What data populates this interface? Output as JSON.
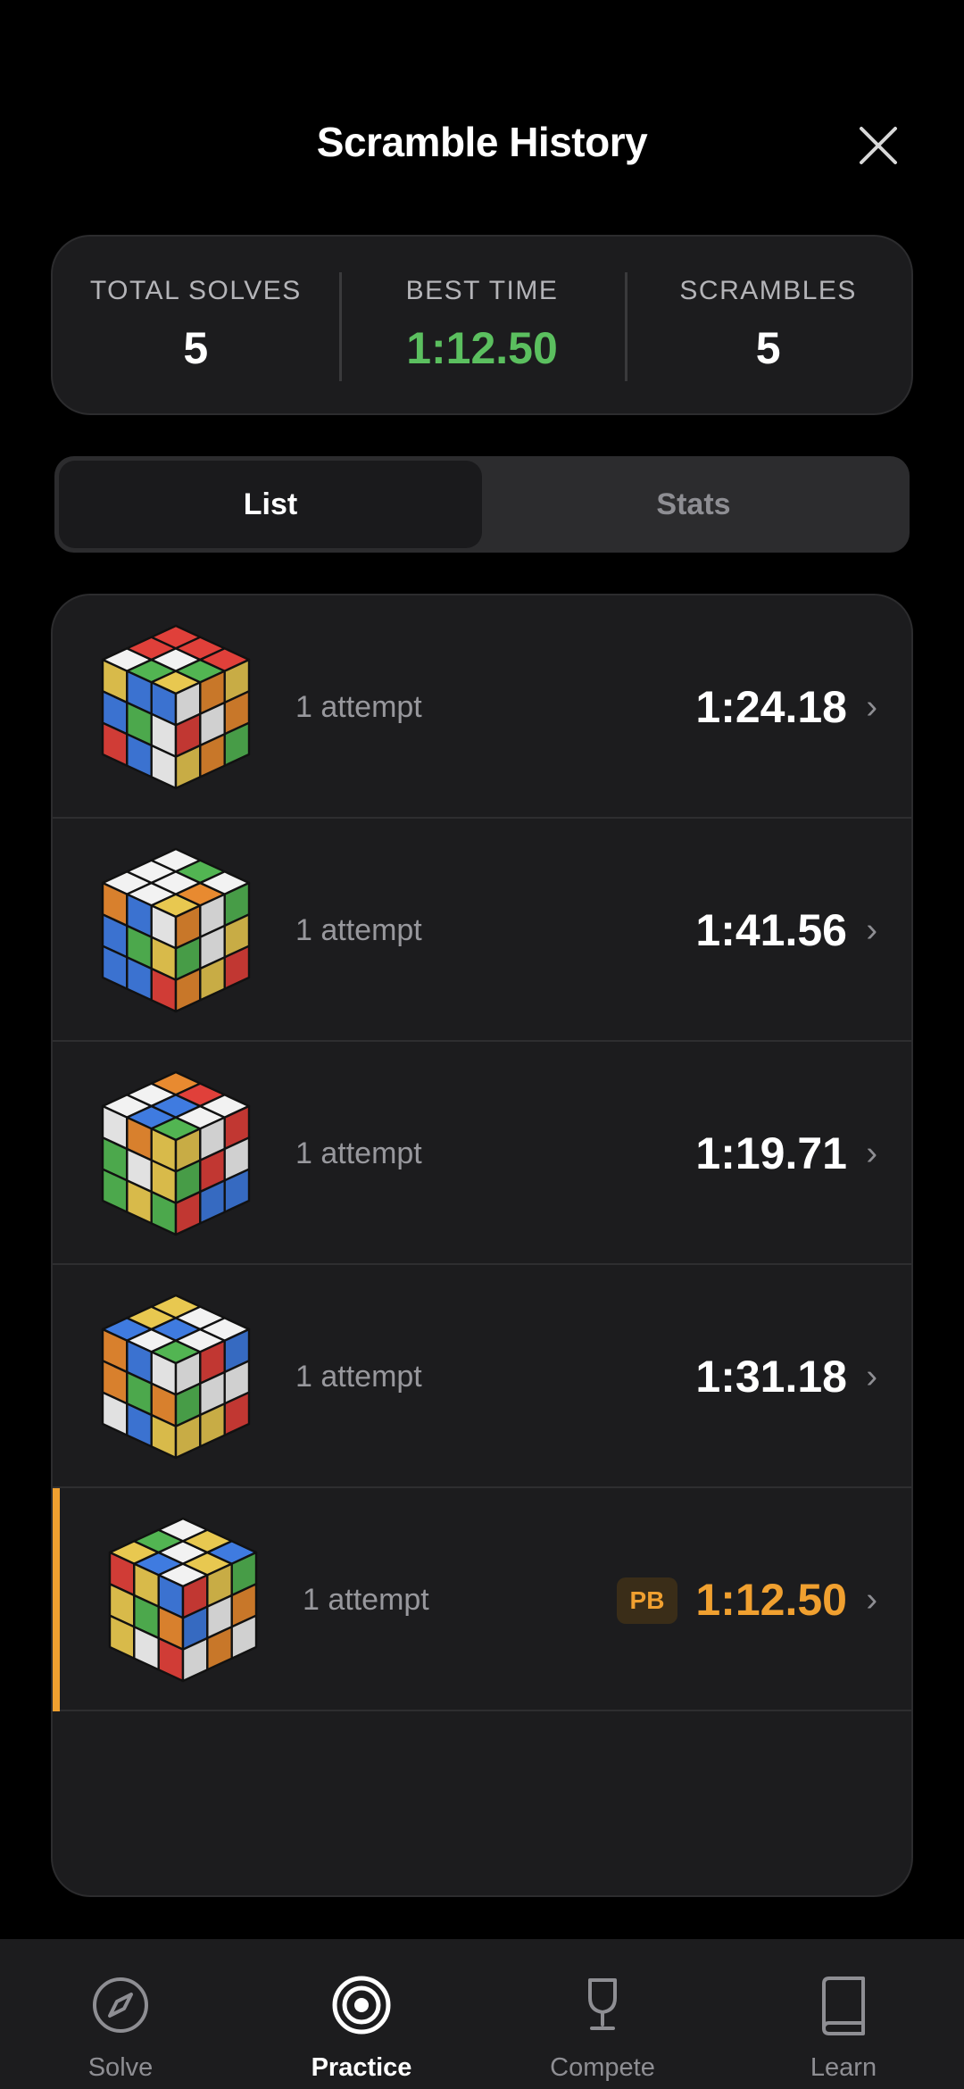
{
  "header": {
    "title": "Scramble History"
  },
  "summary": {
    "total_label": "TOTAL SOLVES",
    "total_value": "5",
    "best_label": "BEST TIME",
    "best_value": "1:12.50",
    "scrambles_label": "SCRAMBLES",
    "scrambles_value": "5",
    "best_color": "#5bbf5f"
  },
  "segments": {
    "list": "List",
    "stats": "Stats",
    "active": "List"
  },
  "scrambles": [
    {
      "attempts": "1 attempt",
      "time": "1:24.18",
      "pb": false,
      "top": [
        "w",
        "r",
        "r",
        "g",
        "w",
        "r",
        "y",
        "g",
        "r"
      ],
      "left": [
        "y",
        "b",
        "b",
        "b",
        "g",
        "w",
        "r",
        "b",
        "w"
      ],
      "right": [
        "w",
        "o",
        "y",
        "r",
        "w",
        "o",
        "y",
        "o",
        "g"
      ]
    },
    {
      "attempts": "1 attempt",
      "time": "1:41.56",
      "pb": false,
      "top": [
        "w",
        "w",
        "w",
        "w",
        "w",
        "g",
        "y",
        "o",
        "w"
      ],
      "left": [
        "o",
        "b",
        "w",
        "b",
        "g",
        "y",
        "b",
        "b",
        "r"
      ],
      "right": [
        "o",
        "w",
        "g",
        "g",
        "w",
        "y",
        "o",
        "y",
        "r"
      ]
    },
    {
      "attempts": "1 attempt",
      "time": "1:19.71",
      "pb": false,
      "top": [
        "w",
        "w",
        "o",
        "b",
        "b",
        "r",
        "g",
        "w",
        "w"
      ],
      "left": [
        "w",
        "o",
        "y",
        "g",
        "w",
        "y",
        "g",
        "y",
        "g"
      ],
      "right": [
        "y",
        "w",
        "r",
        "g",
        "r",
        "w",
        "r",
        "b",
        "b"
      ]
    },
    {
      "attempts": "1 attempt",
      "time": "1:31.18",
      "pb": false,
      "top": [
        "b",
        "y",
        "y",
        "w",
        "b",
        "w",
        "g",
        "w",
        "w"
      ],
      "left": [
        "o",
        "b",
        "w",
        "o",
        "g",
        "o",
        "w",
        "b",
        "y"
      ],
      "right": [
        "w",
        "r",
        "b",
        "g",
        "w",
        "w",
        "y",
        "y",
        "r"
      ]
    },
    {
      "attempts": "1 attempt",
      "time": "1:12.50",
      "pb": true,
      "badge": "PB",
      "top": [
        "y",
        "g",
        "w",
        "b",
        "w",
        "y",
        "w",
        "y",
        "b"
      ],
      "left": [
        "r",
        "y",
        "b",
        "y",
        "g",
        "o",
        "y",
        "w",
        "r"
      ],
      "right": [
        "r",
        "y",
        "g",
        "b",
        "w",
        "o",
        "w",
        "o",
        "w"
      ]
    }
  ],
  "tabs": [
    {
      "label": "Solve",
      "icon": "compass-icon",
      "active": false
    },
    {
      "label": "Practice",
      "icon": "target-icon",
      "active": true
    },
    {
      "label": "Compete",
      "icon": "trophy-icon",
      "active": false
    },
    {
      "label": "Learn",
      "icon": "book-icon",
      "active": false
    }
  ],
  "colors": {
    "accent": "#f0a030",
    "sticker_w": "#f2f2f2",
    "sticker_r": "#e0403a",
    "sticker_g": "#52b552",
    "sticker_b": "#3f7be0",
    "sticker_o": "#e88a30",
    "sticker_y": "#e8c850"
  }
}
